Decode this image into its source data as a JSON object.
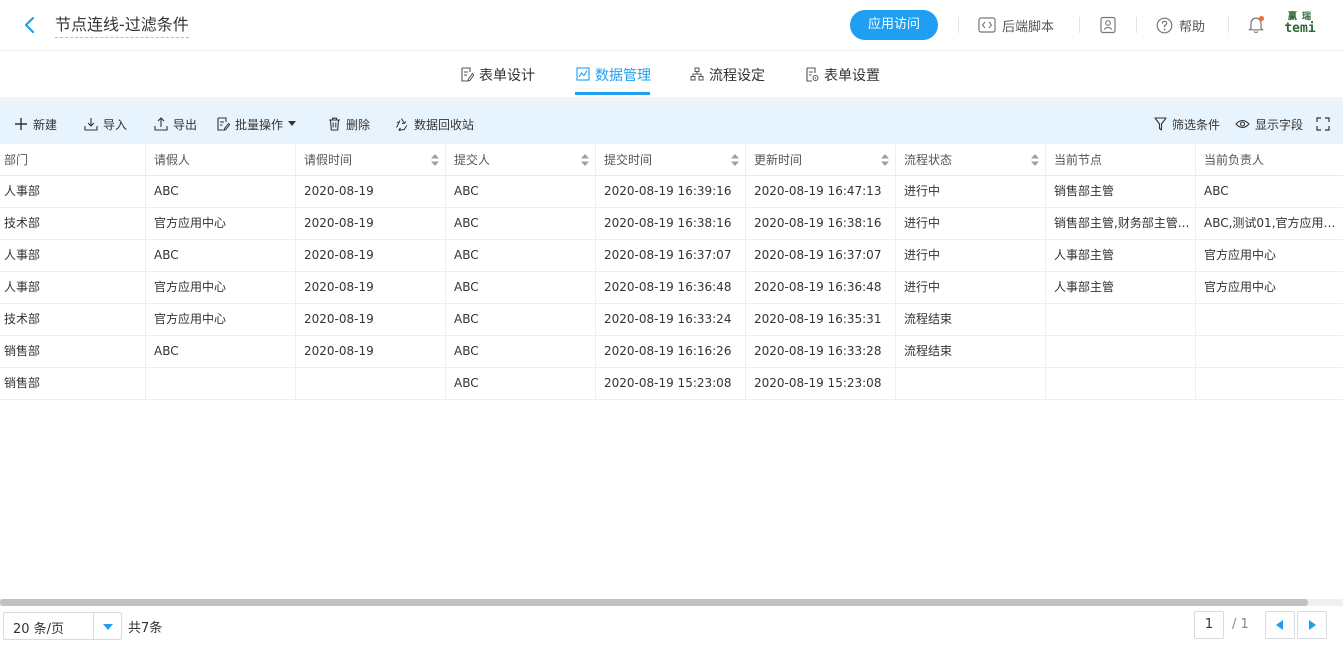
{
  "header": {
    "title": "节点连线-过滤条件",
    "visit_label": "应用访问",
    "script_label": "后端脚本",
    "help_label": "帮助",
    "logo_line1": "赢 瑞",
    "logo_line2": "temi"
  },
  "tabs": [
    {
      "label": "表单设计",
      "icon": "form-edit-icon"
    },
    {
      "label": "数据管理",
      "icon": "chart-icon",
      "active": true
    },
    {
      "label": "流程设定",
      "icon": "flow-icon"
    },
    {
      "label": "表单设置",
      "icon": "form-settings-icon"
    }
  ],
  "toolbar": {
    "new_label": "新建",
    "import_label": "导入",
    "export_label": "导出",
    "batch_label": "批量操作",
    "delete_label": "删除",
    "recycle_label": "数据回收站",
    "filter_label": "筛选条件",
    "fields_label": "显示字段"
  },
  "table": {
    "columns": [
      "部门",
      "请假人",
      "请假时间",
      "提交人",
      "提交时间",
      "更新时间",
      "流程状态",
      "当前节点",
      "当前负责人"
    ],
    "rows": [
      [
        "人事部",
        "ABC",
        "2020-08-19",
        "ABC",
        "2020-08-19 16:39:16",
        "2020-08-19 16:47:13",
        "进行中",
        "销售部主管",
        "ABC"
      ],
      [
        "技术部",
        "官方应用中心",
        "2020-08-19",
        "ABC",
        "2020-08-19 16:38:16",
        "2020-08-19 16:38:16",
        "进行中",
        "销售部主管,财务部主管...",
        "ABC,测试01,官方应用中..."
      ],
      [
        "人事部",
        "ABC",
        "2020-08-19",
        "ABC",
        "2020-08-19 16:37:07",
        "2020-08-19 16:37:07",
        "进行中",
        "人事部主管",
        "官方应用中心"
      ],
      [
        "人事部",
        "官方应用中心",
        "2020-08-19",
        "ABC",
        "2020-08-19 16:36:48",
        "2020-08-19 16:36:48",
        "进行中",
        "人事部主管",
        "官方应用中心"
      ],
      [
        "技术部",
        "官方应用中心",
        "2020-08-19",
        "ABC",
        "2020-08-19 16:33:24",
        "2020-08-19 16:35:31",
        "流程结束",
        "",
        ""
      ],
      [
        "销售部",
        "ABC",
        "2020-08-19",
        "ABC",
        "2020-08-19 16:16:26",
        "2020-08-19 16:33:28",
        "流程结束",
        "",
        ""
      ],
      [
        "销售部",
        "",
        "",
        "ABC",
        "2020-08-19 15:23:08",
        "2020-08-19 15:23:08",
        "",
        "",
        ""
      ]
    ]
  },
  "pagination": {
    "page_size": "20 条/页",
    "total": "共7条",
    "current": "1",
    "pages": "/ 1"
  },
  "colors": {
    "accent": "#1e9ff2",
    "toolbar_bg": "#e8f4fd"
  }
}
